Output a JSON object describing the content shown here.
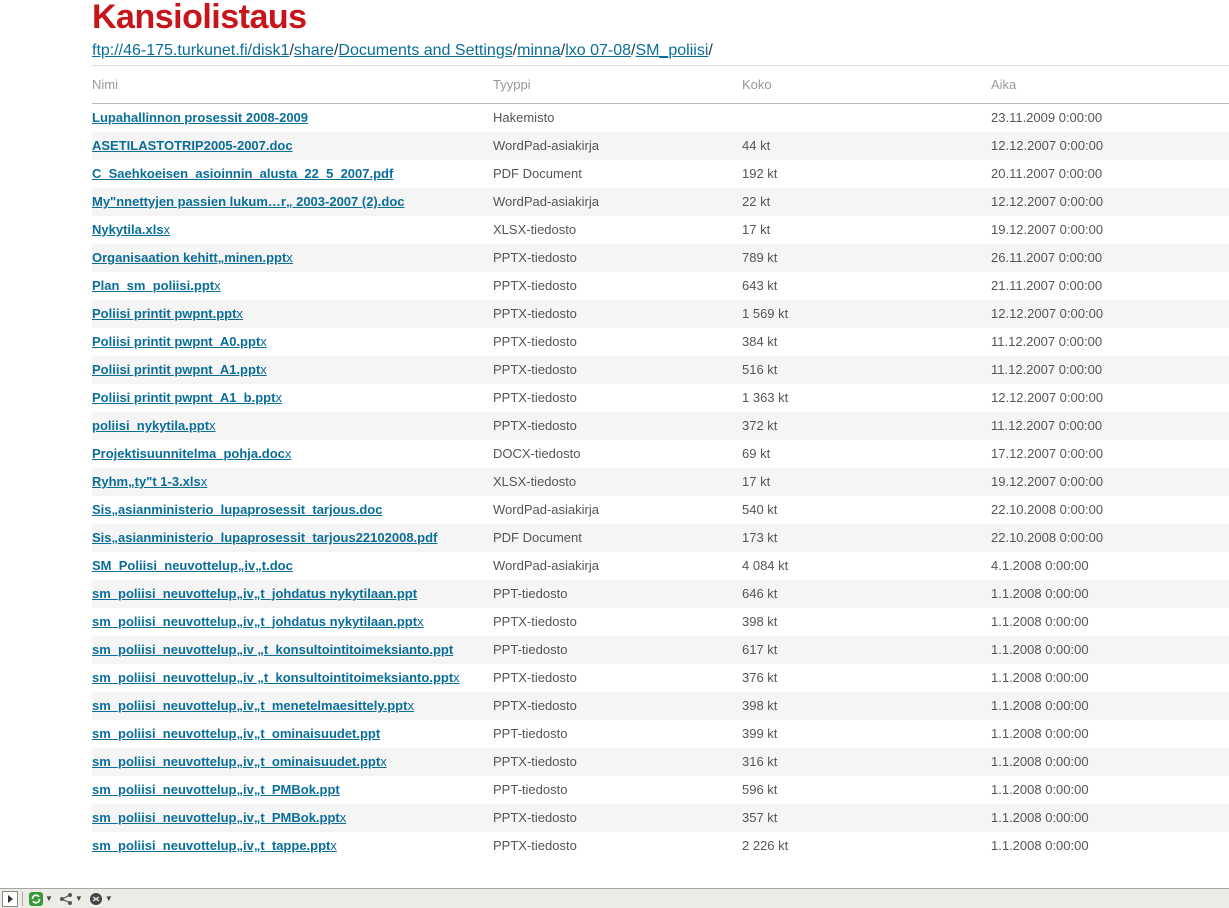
{
  "page": {
    "title": "Kansiolistaus",
    "breadcrumb": [
      {
        "label": "ftp://46-175.turkunet.fi/disk1"
      },
      {
        "label": "share"
      },
      {
        "label": "Documents and Settings"
      },
      {
        "label": "minna"
      },
      {
        "label": "lxo 07-08"
      },
      {
        "label": "SM_poliisi"
      }
    ],
    "breadcrumb_separator": "/"
  },
  "table": {
    "columns": [
      "Nimi",
      "Tyyppi",
      "Koko",
      "Aika"
    ],
    "rows": [
      {
        "base": "Lupahallinnon prosessit 2008-2009",
        "ext": "",
        "type": "Hakemisto",
        "size": "",
        "time": "23.11.2009 0:00:00"
      },
      {
        "base": "ASETILASTOTRIP2005-2007.doc",
        "ext": "",
        "type": "WordPad-asiakirja",
        "size": "44 kt",
        "time": "12.12.2007 0:00:00"
      },
      {
        "base": "C_Saehkoeisen_asioinnin_alusta_22_5_2007.pdf",
        "ext": "",
        "type": "PDF Document",
        "size": "192 kt",
        "time": "20.11.2007 0:00:00"
      },
      {
        "base": "My\"nnettyjen passien lukum…r„ 2003-2007 (2).doc",
        "ext": "",
        "type": "WordPad-asiakirja",
        "size": "22 kt",
        "time": "12.12.2007 0:00:00"
      },
      {
        "base": "Nykytila.xls",
        "ext": "x",
        "type": "XLSX-tiedosto",
        "size": "17 kt",
        "time": "19.12.2007 0:00:00"
      },
      {
        "base": "Organisaation kehitt„minen.ppt",
        "ext": "x",
        "type": "PPTX-tiedosto",
        "size": "789 kt",
        "time": "26.11.2007 0:00:00"
      },
      {
        "base": "Plan_sm_poliisi.ppt",
        "ext": "x",
        "type": "PPTX-tiedosto",
        "size": "643 kt",
        "time": "21.11.2007 0:00:00"
      },
      {
        "base": "Poliisi printit pwpnt.ppt",
        "ext": "x",
        "type": "PPTX-tiedosto",
        "size": "1 569 kt",
        "time": "12.12.2007 0:00:00"
      },
      {
        "base": "Poliisi printit pwpnt_A0.ppt",
        "ext": "x",
        "type": "PPTX-tiedosto",
        "size": "384 kt",
        "time": "11.12.2007 0:00:00"
      },
      {
        "base": "Poliisi printit pwpnt_A1.ppt",
        "ext": "x",
        "type": "PPTX-tiedosto",
        "size": "516 kt",
        "time": "11.12.2007 0:00:00"
      },
      {
        "base": "Poliisi printit pwpnt_A1_b.ppt",
        "ext": "x",
        "type": "PPTX-tiedosto",
        "size": "1 363 kt",
        "time": "12.12.2007 0:00:00"
      },
      {
        "base": "poliisi_nykytila.ppt",
        "ext": "x",
        "type": "PPTX-tiedosto",
        "size": "372 kt",
        "time": "11.12.2007 0:00:00"
      },
      {
        "base": "Projektisuunnitelma_pohja.doc",
        "ext": "x",
        "type": "DOCX-tiedosto",
        "size": "69 kt",
        "time": "17.12.2007 0:00:00"
      },
      {
        "base": "Ryhm„ty\"t 1-3.xls",
        "ext": "x",
        "type": "XLSX-tiedosto",
        "size": "17 kt",
        "time": "19.12.2007 0:00:00"
      },
      {
        "base": "Sis„asianministerio_lupaprosessit_tarjous.doc",
        "ext": "",
        "type": "WordPad-asiakirja",
        "size": "540 kt",
        "time": "22.10.2008 0:00:00"
      },
      {
        "base": "Sis„asianministerio_lupaprosessit_tarjous22102008.pdf",
        "ext": "",
        "type": "PDF Document",
        "size": "173 kt",
        "time": "22.10.2008 0:00:00"
      },
      {
        "base": "SM_Poliisi_neuvottelup„iv„t.doc",
        "ext": "",
        "type": "WordPad-asiakirja",
        "size": "4 084 kt",
        "time": "4.1.2008 0:00:00"
      },
      {
        "base": "sm_poliisi_neuvottelup„iv„t_johdatus nykytilaan.ppt",
        "ext": "",
        "type": "PPT-tiedosto",
        "size": "646 kt",
        "time": "1.1.2008 0:00:00"
      },
      {
        "base": "sm_poliisi_neuvottelup„iv„t_johdatus nykytilaan.ppt",
        "ext": "x",
        "type": "PPTX-tiedosto",
        "size": "398 kt",
        "time": "1.1.2008 0:00:00"
      },
      {
        "base": "sm_poliisi_neuvottelup„iv „t_konsultointitoimeksianto.ppt",
        "ext": "",
        "type": "PPT-tiedosto",
        "size": "617 kt",
        "time": "1.1.2008 0:00:00"
      },
      {
        "base": "sm_poliisi_neuvottelup„iv „t_konsultointitoimeksianto.ppt",
        "ext": "x",
        "type": "PPTX-tiedosto",
        "size": "376 kt",
        "time": "1.1.2008 0:00:00"
      },
      {
        "base": "sm_poliisi_neuvottelup„iv„t_menetelmaesittely.ppt",
        "ext": "x",
        "type": "PPTX-tiedosto",
        "size": "398 kt",
        "time": "1.1.2008 0:00:00"
      },
      {
        "base": "sm_poliisi_neuvottelup„iv„t_ominaisuudet.ppt",
        "ext": "",
        "type": "PPT-tiedosto",
        "size": "399 kt",
        "time": "1.1.2008 0:00:00"
      },
      {
        "base": "sm_poliisi_neuvottelup„iv„t_ominaisuudet.ppt",
        "ext": "x",
        "type": "PPTX-tiedosto",
        "size": "316 kt",
        "time": "1.1.2008 0:00:00"
      },
      {
        "base": "sm_poliisi_neuvottelup„iv„t_PMBok.ppt",
        "ext": "",
        "type": "PPT-tiedosto",
        "size": "596 kt",
        "time": "1.1.2008 0:00:00"
      },
      {
        "base": "sm_poliisi_neuvottelup„iv„t_PMBok.ppt",
        "ext": "x",
        "type": "PPTX-tiedosto",
        "size": "357 kt",
        "time": "1.1.2008 0:00:00"
      },
      {
        "base": "sm_poliisi_neuvottelup„iv„t_tappe.ppt",
        "ext": "x",
        "type": "PPTX-tiedosto",
        "size": "2 226 kt",
        "time": "1.1.2008 0:00:00"
      }
    ]
  },
  "statusbar": {
    "icons": [
      "panel-toggle-icon",
      "sync-icon",
      "connection-icon",
      "globe-icon"
    ],
    "colors": {
      "sync": "#3a9a3a",
      "globe": "#444444"
    }
  }
}
